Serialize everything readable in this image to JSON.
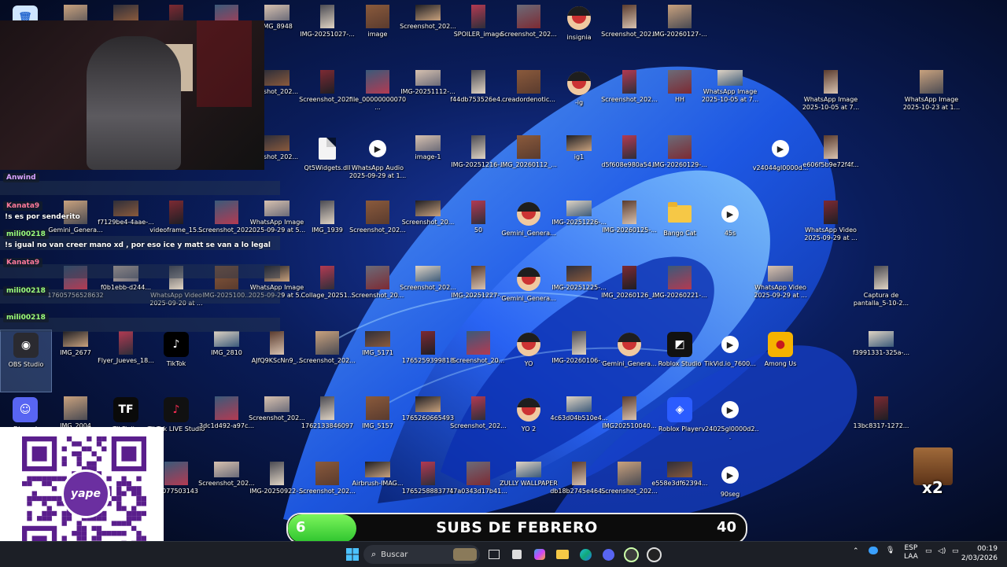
{
  "desktop": {
    "icons": [
      {
        "label": "",
        "type": "trash"
      },
      {
        "label": "",
        "type": "photo"
      },
      {
        "label": "",
        "type": "photo"
      },
      {
        "label": "",
        "type": "photo"
      },
      {
        "label": "",
        "type": "photo"
      },
      {
        "label": "IMG_8948",
        "type": "photo"
      },
      {
        "label": "IMG-20251027-...",
        "type": "photo"
      },
      {
        "label": "image",
        "type": "photo"
      },
      {
        "label": "Screenshot_202...",
        "type": "photo"
      },
      {
        "label": "SPOILER_image",
        "type": "photo"
      },
      {
        "label": "Screenshot_202...",
        "type": "photo"
      },
      {
        "label": "insignia",
        "type": "avatar"
      },
      {
        "label": "Screenshot_202...",
        "type": "photo"
      },
      {
        "label": "IMG-20260127-...",
        "type": "photo"
      },
      {
        "label": "enshot_202...",
        "type": "photo"
      },
      {
        "label": "Screenshot_202...",
        "type": "photo"
      },
      {
        "label": "file_00000000070...",
        "type": "photo"
      },
      {
        "label": "IMG-20251112-...",
        "type": "photo"
      },
      {
        "label": "f44db753526e4...",
        "type": "photo"
      },
      {
        "label": "creadordenotic...",
        "type": "photo"
      },
      {
        "label": "-ig",
        "type": "avatar"
      },
      {
        "label": "Screenshot_202...",
        "type": "photo"
      },
      {
        "label": "HH",
        "type": "photo"
      },
      {
        "label": "WhatsApp Image 2025-10-05 at 7...",
        "type": "photo"
      },
      {
        "label": "WhatsApp Image 2025-10-05 at 7...",
        "type": "photo"
      },
      {
        "label": "WhatsApp Image 2025-10-23 at 1...",
        "type": "photo"
      },
      {
        "label": "enshot_202...",
        "type": "photo"
      },
      {
        "label": "Qt5Widgets.dll",
        "type": "doc"
      },
      {
        "label": "WhatsApp Audio 2025-09-29 at 1...",
        "type": "video"
      },
      {
        "label": "image-1",
        "type": "photo"
      },
      {
        "label": "IMG-20251216-...",
        "type": "photo"
      },
      {
        "label": "IMG_20260112_...",
        "type": "photo"
      },
      {
        "label": "ig1",
        "type": "photo"
      },
      {
        "label": "d5f608e980a54...",
        "type": "photo"
      },
      {
        "label": "IMG-20260129-...",
        "type": "photo"
      },
      {
        "label": "v24044gl0000d...",
        "type": "video"
      },
      {
        "label": "e606f5b9e72f4f...",
        "type": "photo"
      },
      {
        "label": "Gemini_Genera...",
        "type": "photo"
      },
      {
        "label": "f7129be4-4aae-...",
        "type": "photo"
      },
      {
        "label": "videoframe_15...",
        "type": "photo"
      },
      {
        "label": "Screenshot_202...",
        "type": "photo"
      },
      {
        "label": "WhatsApp Image 2025-09-29 at 5...",
        "type": "photo"
      },
      {
        "label": "IMG_1939",
        "type": "photo"
      },
      {
        "label": "Screenshot_202...",
        "type": "photo"
      },
      {
        "label": "Screenshot_20...",
        "type": "photo"
      },
      {
        "label": "50",
        "type": "photo"
      },
      {
        "label": "Gemini_Genera...",
        "type": "avatar"
      },
      {
        "label": "IMG-20251226-...",
        "type": "photo"
      },
      {
        "label": "IMG-20260125-...",
        "type": "photo"
      },
      {
        "label": "Bango Cat",
        "type": "folder"
      },
      {
        "label": "45s",
        "type": "video"
      },
      {
        "label": "WhatsApp Video 2025-09-29 at ...",
        "type": "photo"
      },
      {
        "label": "17605756528632",
        "type": "photo"
      },
      {
        "label": "f0b1ebb-d244...",
        "type": "photo"
      },
      {
        "label": "WhatsApp Video 2025-09-20 at ...",
        "type": "photo"
      },
      {
        "label": "IMG-2025100...",
        "type": "photo"
      },
      {
        "label": "WhatsApp Image 2025-09-29 at 5...",
        "type": "photo"
      },
      {
        "label": "Collage_20251...",
        "type": "photo"
      },
      {
        "label": "Screenshot_20...",
        "type": "photo"
      },
      {
        "label": "Screenshot_202...",
        "type": "photo"
      },
      {
        "label": "IMG-20251227-...",
        "type": "photo"
      },
      {
        "label": "Gemini_Genera...",
        "type": "avatar"
      },
      {
        "label": "IMG-20251225-...",
        "type": "photo"
      },
      {
        "label": "IMG_20260126_...",
        "type": "photo"
      },
      {
        "label": "IMG-20260221-...",
        "type": "photo"
      },
      {
        "label": "WhatsApp Video 2025-09-29 at ...",
        "type": "photo"
      },
      {
        "label": "Captura de pantalla_5-10-2...",
        "type": "photo"
      },
      {
        "label": "OBS Studio",
        "type": "obs"
      },
      {
        "label": "IMG_2677",
        "type": "photo"
      },
      {
        "label": "Flyer_Jueves_18...",
        "type": "photo"
      },
      {
        "label": "TikTok",
        "type": "tiktok"
      },
      {
        "label": "IMG_2810",
        "type": "photo"
      },
      {
        "label": "AJfQ9KScNn9_...",
        "type": "photo"
      },
      {
        "label": "Screenshot_202...",
        "type": "photo"
      },
      {
        "label": "IMG_5171",
        "type": "photo"
      },
      {
        "label": "1765259399818",
        "type": "photo"
      },
      {
        "label": "Screenshot_20...",
        "type": "photo"
      },
      {
        "label": "YO",
        "type": "avatar"
      },
      {
        "label": "IMG-20260106-...",
        "type": "photo"
      },
      {
        "label": "Gemini_Genera...",
        "type": "avatar"
      },
      {
        "label": "Roblox Studio",
        "type": "roblox-studio"
      },
      {
        "label": "TikVid.io_7600...",
        "type": "video"
      },
      {
        "label": "Among Us",
        "type": "amongus"
      },
      {
        "label": "f3991331-325a-...",
        "type": "photo"
      },
      {
        "label": "Discord",
        "type": "discord"
      },
      {
        "label": "IMG_2004",
        "type": "photo"
      },
      {
        "label": "TikFinity",
        "type": "tikfinity"
      },
      {
        "label": "TikTok LIVE Studio",
        "type": "tiktok-live"
      },
      {
        "label": "3dc1d492-a97c...",
        "type": "photo"
      },
      {
        "label": "Screenshot_202...",
        "type": "photo"
      },
      {
        "label": "1762133846097",
        "type": "photo"
      },
      {
        "label": "IMG_5157",
        "type": "photo"
      },
      {
        "label": "1765260665493",
        "type": "photo"
      },
      {
        "label": "Screenshot_202...",
        "type": "photo"
      },
      {
        "label": "YO 2",
        "type": "avatar"
      },
      {
        "label": "4c63d04b510e4...",
        "type": "photo"
      },
      {
        "label": "IMG202510040...",
        "type": "photo"
      },
      {
        "label": "Roblox Player",
        "type": "roblox"
      },
      {
        "label": "v24025gl0000d2...",
        "type": "video"
      },
      {
        "label": "13bc8317-1272...",
        "type": "photo"
      },
      {
        "label": "59077503143",
        "type": "photo"
      },
      {
        "label": "Screenshot_202...",
        "type": "photo"
      },
      {
        "label": "IMG-20250922-...",
        "type": "photo"
      },
      {
        "label": "Screenshot_202...",
        "type": "photo"
      },
      {
        "label": "Airbrush-IMAG...",
        "type": "photo"
      },
      {
        "label": "1765258883771",
        "type": "photo"
      },
      {
        "label": "47a0343d17b41...",
        "type": "photo"
      },
      {
        "label": "ZULLY WALLPAPER",
        "type": "photo"
      },
      {
        "label": "db18b2745e464...",
        "type": "photo"
      },
      {
        "label": "Screenshot_202...",
        "type": "photo"
      },
      {
        "label": "e558e3df62394...",
        "type": "photo"
      },
      {
        "label": "90seg",
        "type": "video"
      }
    ]
  },
  "chat": {
    "messages": [
      {
        "user": "Anwind",
        "text": "",
        "user_color": "#d9a3ff"
      },
      {
        "user": "Kanata9",
        "text": "!s es por senderito",
        "user_color": "#ff7a9a"
      },
      {
        "user": "mili00218",
        "text": "!s igual no van creer mano xd , por eso ice y matt se van a lo legal",
        "user_color": "#9dff7a"
      },
      {
        "user": "Kanata9",
        "text": "",
        "user_color": "#ff7a9a"
      },
      {
        "user": "mili00218",
        "text": "",
        "user_color": "#9dff7a"
      },
      {
        "user": "mili00218",
        "text": "",
        "user_color": "#9dff7a"
      }
    ]
  },
  "qr": {
    "brand": "yape",
    "color": "#5a1e8c"
  },
  "subs_goal": {
    "title": "SUBS DE FEBRERO",
    "current": "6",
    "goal": "40",
    "progress": 0.15,
    "fill_color": "#4cd93a"
  },
  "overlay": {
    "meme_text": "x2"
  },
  "taskbar": {
    "search_placeholder": "Buscar",
    "tray": {
      "lang_top": "ESP",
      "lang_bottom": "LAA",
      "time": "00:19",
      "date": "2/03/2026"
    },
    "apps": [
      {
        "name": "file-explorer-icon",
        "glyph": "📁"
      },
      {
        "name": "edge-icon",
        "glyph": "◐"
      },
      {
        "name": "discord-taskbar-icon",
        "glyph": "☻"
      },
      {
        "name": "app-icon-1",
        "glyph": "◍"
      },
      {
        "name": "app-icon-2",
        "glyph": "◎"
      }
    ]
  }
}
